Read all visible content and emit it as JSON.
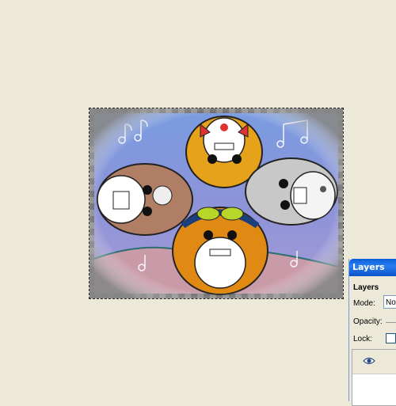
{
  "layers_panel": {
    "title": "Layers",
    "heading": "Layers",
    "mode_label": "Mode:",
    "mode_value": "Normal",
    "opacity_label": "Opacity:",
    "lock_label": "Lock:",
    "lock_checked": false
  },
  "canvas": {
    "image_name": "hamsters-artwork",
    "selection": "marching-ants",
    "transparency_pattern": "checkerboard"
  },
  "colors": {
    "panel_titlebar": "#0a5fd8",
    "workspace": "#ece9d8"
  },
  "icons": {
    "layer_visibility": "eye-icon"
  }
}
